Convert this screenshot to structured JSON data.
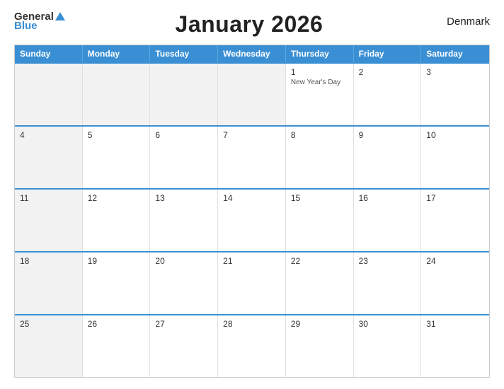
{
  "header": {
    "title": "January 2026",
    "country": "Denmark",
    "logo": {
      "general": "General",
      "blue": "Blue"
    }
  },
  "weekdays": [
    "Sunday",
    "Monday",
    "Tuesday",
    "Wednesday",
    "Thursday",
    "Friday",
    "Saturday"
  ],
  "weeks": [
    [
      {
        "day": "",
        "holiday": "",
        "gray": true
      },
      {
        "day": "",
        "holiday": "",
        "gray": true
      },
      {
        "day": "",
        "holiday": "",
        "gray": true
      },
      {
        "day": "",
        "holiday": "",
        "gray": true
      },
      {
        "day": "1",
        "holiday": "New Year's Day",
        "gray": false
      },
      {
        "day": "2",
        "holiday": "",
        "gray": false
      },
      {
        "day": "3",
        "holiday": "",
        "gray": false
      }
    ],
    [
      {
        "day": "4",
        "holiday": "",
        "gray": true
      },
      {
        "day": "5",
        "holiday": "",
        "gray": false
      },
      {
        "day": "6",
        "holiday": "",
        "gray": false
      },
      {
        "day": "7",
        "holiday": "",
        "gray": false
      },
      {
        "day": "8",
        "holiday": "",
        "gray": false
      },
      {
        "day": "9",
        "holiday": "",
        "gray": false
      },
      {
        "day": "10",
        "holiday": "",
        "gray": false
      }
    ],
    [
      {
        "day": "11",
        "holiday": "",
        "gray": true
      },
      {
        "day": "12",
        "holiday": "",
        "gray": false
      },
      {
        "day": "13",
        "holiday": "",
        "gray": false
      },
      {
        "day": "14",
        "holiday": "",
        "gray": false
      },
      {
        "day": "15",
        "holiday": "",
        "gray": false
      },
      {
        "day": "16",
        "holiday": "",
        "gray": false
      },
      {
        "day": "17",
        "holiday": "",
        "gray": false
      }
    ],
    [
      {
        "day": "18",
        "holiday": "",
        "gray": true
      },
      {
        "day": "19",
        "holiday": "",
        "gray": false
      },
      {
        "day": "20",
        "holiday": "",
        "gray": false
      },
      {
        "day": "21",
        "holiday": "",
        "gray": false
      },
      {
        "day": "22",
        "holiday": "",
        "gray": false
      },
      {
        "day": "23",
        "holiday": "",
        "gray": false
      },
      {
        "day": "24",
        "holiday": "",
        "gray": false
      }
    ],
    [
      {
        "day": "25",
        "holiday": "",
        "gray": true
      },
      {
        "day": "26",
        "holiday": "",
        "gray": false
      },
      {
        "day": "27",
        "holiday": "",
        "gray": false
      },
      {
        "day": "28",
        "holiday": "",
        "gray": false
      },
      {
        "day": "29",
        "holiday": "",
        "gray": false
      },
      {
        "day": "30",
        "holiday": "",
        "gray": false
      },
      {
        "day": "31",
        "holiday": "",
        "gray": false
      }
    ]
  ],
  "colors": {
    "accent": "#3a8fd4",
    "header_bg": "#3a8fd4",
    "sunday_bg": "#f2f2f2",
    "border": "#ccc"
  }
}
